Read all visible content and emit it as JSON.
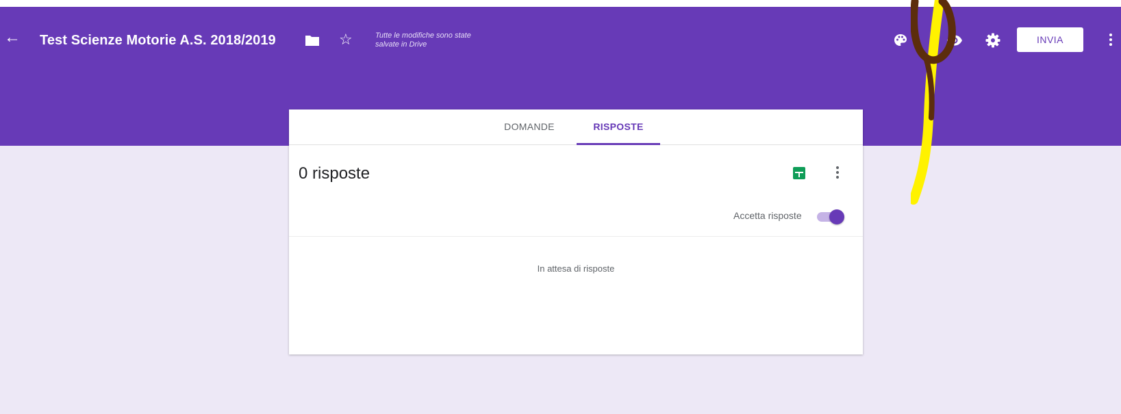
{
  "header": {
    "title": "Test Scienze Motorie A.S. 2018/2019",
    "save_status_line1": "Tutte le modifiche sono state",
    "save_status_line2": "salvate in Drive",
    "send_label": "INVIA",
    "accent_color": "#673ab7",
    "icons": [
      "back-arrow-icon",
      "folder-icon",
      "star-icon",
      "palette-icon",
      "eye-icon",
      "gear-icon",
      "more-vert-icon"
    ]
  },
  "tabs": [
    {
      "label": "DOMANDE",
      "active": false
    },
    {
      "label": "RISPOSTE",
      "active": true
    }
  ],
  "responses": {
    "count_label": "0 risposte",
    "accept_label": "Accetta risposte",
    "accepting": true,
    "empty_message": "In attesa di risposte"
  },
  "annotation": {
    "colors": [
      "#fff200",
      "#5c2d0c"
    ]
  }
}
